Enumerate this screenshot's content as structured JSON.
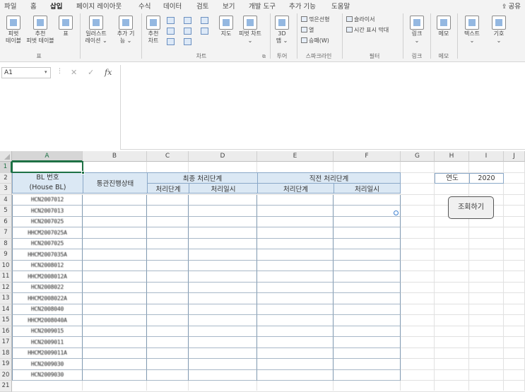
{
  "menu": {
    "tabs": [
      "파일",
      "홈",
      "삽입",
      "페이지 레이아웃",
      "수식",
      "데이터",
      "검토",
      "보기",
      "개발 도구",
      "추가 기능",
      "도움말"
    ],
    "active": "삽입",
    "share_icon": "share-icon",
    "share_label": "공유"
  },
  "ribbon": {
    "pivot": "피벗\n테이블",
    "recommended_pivot": "추천\n피벗 테이블",
    "table": "표",
    "illustrations": "일러스트\n레이션 ⌄",
    "addins": "추가 기\n능 ⌄",
    "recommended_charts": "추천\n차트",
    "map": "지도",
    "pivot_chart": "피벗 차트\n⌄",
    "map3d": "3D\n맵 ⌄",
    "spark_line": "꺾은선형",
    "spark_column": "열",
    "spark_winloss": "승패(W)",
    "slicer": "슬라이서",
    "timeline": "시간 표시 막대",
    "link": "링크\n⌄",
    "comment": "메모",
    "text": "텍스트\n⌄",
    "symbol": "기호\n⌄",
    "groups": {
      "tables": "표",
      "charts": "차트",
      "tours": "투어",
      "sparklines": "스파크라인",
      "filters": "필터",
      "links": "링크",
      "comments": "메모"
    }
  },
  "formula_bar": {
    "name_box": "A1",
    "dots": "⋮",
    "cancel": "✕",
    "enter": "✓",
    "fx": "fx",
    "value": ""
  },
  "sheet": {
    "columns": [
      "A",
      "B",
      "C",
      "D",
      "E",
      "F",
      "G",
      "H",
      "I",
      "J"
    ],
    "rows": [
      "1",
      "2",
      "3",
      "4",
      "5",
      "6",
      "7",
      "8",
      "9",
      "10",
      "11",
      "12",
      "13",
      "14",
      "15",
      "16",
      "17",
      "18",
      "19",
      "20",
      "21"
    ],
    "selected_cell": "A1"
  },
  "table": {
    "bl_header_line1": "BL 번호",
    "bl_header_line2": "(House BL)",
    "customs_status": "통관진행상태",
    "final_stage": "최종 처리단계",
    "previous_stage": "직전 처리단계",
    "stage": "처리단계",
    "datetime": "처리일시",
    "bl_numbers": [
      "HCN2007012",
      "HCN2007013",
      "HCN2007025",
      "HHCM2007025A",
      "HCN2007025",
      "HHCM2007035A",
      "HCN2008012",
      "HHCM2008012A",
      "HCN2008022",
      "HHCM2008022A",
      "HCN2008040",
      "HHCM2008040A",
      "HCN2009015",
      "HCN2009011",
      "HHCM2009011A",
      "HCN2009030",
      "HCN2009030"
    ]
  },
  "controls": {
    "year_label": "연도",
    "year_value": "2020",
    "lookup_button": "조회하기"
  }
}
